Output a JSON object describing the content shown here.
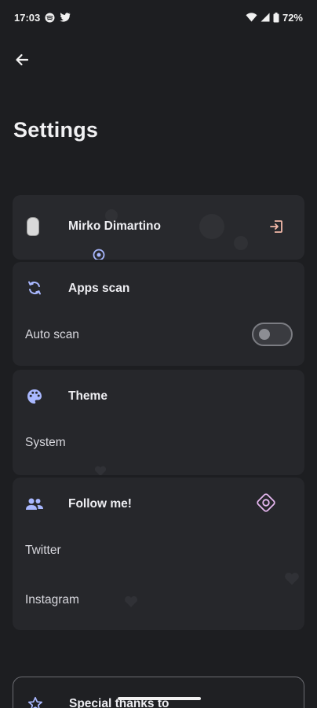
{
  "status_bar": {
    "time": "17:03",
    "battery": "72%"
  },
  "page": {
    "title": "Settings"
  },
  "profile": {
    "name": "Mirko Dimartino"
  },
  "apps_scan": {
    "title": "Apps scan",
    "auto_scan_label": "Auto scan",
    "auto_scan_enabled": false
  },
  "theme": {
    "title": "Theme",
    "value": "System"
  },
  "follow": {
    "title": "Follow me!",
    "items": [
      {
        "label": "Twitter"
      },
      {
        "label": "Instagram"
      }
    ]
  },
  "thanks": {
    "title": "Special thanks to"
  },
  "colors": {
    "background": "#1d1e21",
    "card": "#26272b",
    "icon_accent": "#a9b8ff",
    "logout_accent": "#f2b8a8",
    "target_accent": "#e6b7f0",
    "text_primary": "#eeeef2"
  },
  "icons": {
    "back": "arrow-left-icon",
    "logout": "logout-icon",
    "apps_scan": "sync-icon",
    "theme": "palette-icon",
    "follow": "people-icon",
    "thanks": "star-outline-icon"
  }
}
